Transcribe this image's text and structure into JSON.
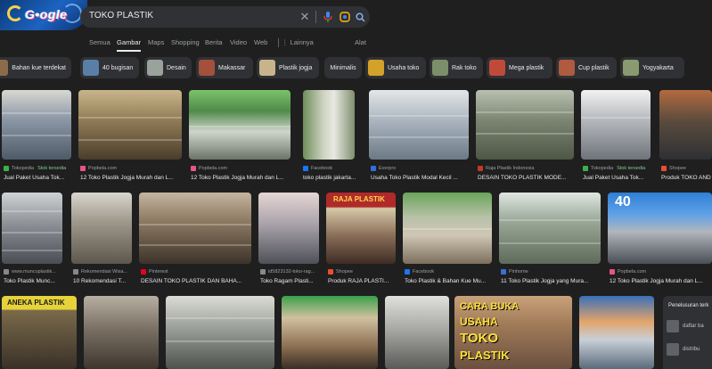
{
  "search": {
    "query": "TOKO PLASTIK",
    "logo_text": "G•ogle"
  },
  "tabs": [
    {
      "label": "Semua"
    },
    {
      "label": "Gambar"
    },
    {
      "label": "Maps"
    },
    {
      "label": "Shopping"
    },
    {
      "label": "Berita"
    },
    {
      "label": "Video"
    },
    {
      "label": "Web"
    },
    {
      "label": "⋮ Lainnya"
    },
    {
      "label": "Alat"
    }
  ],
  "chips": [
    {
      "label": "Bahan kue terdekat",
      "color": "#8c6b4a"
    },
    {
      "label": "40 bugisan",
      "color": "#5a7fa6"
    },
    {
      "label": "Desain",
      "color": "#9aa39b"
    },
    {
      "label": "Makassar",
      "color": "#a3503c"
    },
    {
      "label": "Plastik jogja",
      "color": "#c8b48a"
    },
    {
      "label": "Minimalis",
      "color": "#303134"
    },
    {
      "label": "Usaha toko",
      "color": "#d4a12a"
    },
    {
      "label": "Rak toko",
      "color": "#7b8f6a"
    },
    {
      "label": "Mega plastik",
      "color": "#c04a3a"
    },
    {
      "label": "Cup plastik",
      "color": "#b05a40"
    },
    {
      "label": "Yogyakarta",
      "color": "#8a9a70"
    }
  ],
  "row1": [
    {
      "source": "Tokopedia",
      "badge": "Stok tersedia",
      "caption": "Jual Paket Usaha Tok...",
      "fav": "#3bb14a"
    },
    {
      "source": "Popbela.com",
      "badge": "",
      "caption": "12 Toko Plastik Jogja Murah dan L...",
      "fav": "#e8548a"
    },
    {
      "source": "Popbela.com",
      "badge": "",
      "caption": "12 Toko Plastik Jogja Murah dan L...",
      "fav": "#e8548a"
    },
    {
      "source": "Facebook",
      "badge": "",
      "caption": "toko plastik jakarta...",
      "fav": "#1877f2"
    },
    {
      "source": "Everpro",
      "badge": "",
      "caption": "Usaha Toko Plastik Modal Kecil ...",
      "fav": "#2f6fe0"
    },
    {
      "source": "Raja Plastik Indonesia",
      "badge": "",
      "caption": "DESAIN TOKO PLASTIK MODE...",
      "fav": "#c0392b"
    },
    {
      "source": "Tokopedia",
      "badge": "Stok tersedia",
      "caption": "Jual Paket Usaha Tok...",
      "fav": "#3bb14a"
    },
    {
      "source": "Shopee",
      "badge": "",
      "caption": "Produk TOKO AND",
      "fav": "#ee4d2d"
    }
  ],
  "row2": [
    {
      "source": "www.muncuplastik...",
      "badge": "",
      "caption": "Toko Plastik Munc...",
      "fav": "#888888"
    },
    {
      "source": "Rekomendasi Wisa...",
      "badge": "",
      "caption": "10 Rekomendasi T...",
      "fav": "#888888"
    },
    {
      "source": "Pinterest",
      "badge": "",
      "caption": "DESAIN TOKO PLASTIK DAN BAHA...",
      "fav": "#e60023"
    },
    {
      "source": "id5823132-toko-rag...",
      "badge": "",
      "caption": "Toko Ragam Plasti...",
      "fav": "#888888"
    },
    {
      "source": "Shopee",
      "badge": "",
      "caption": "Produk RAJA PLASTI...",
      "fav": "#ee4d2d"
    },
    {
      "source": "Facebook",
      "badge": "",
      "caption": "Toko Plastik & Bahan Kue Mu...",
      "fav": "#1877f2"
    },
    {
      "source": "Pinhome",
      "badge": "",
      "caption": "11 Toko Plastik Jogja yang Mura...",
      "fav": "#3a6fd8"
    },
    {
      "source": "Popbela.com",
      "badge": "",
      "caption": "12 Toko Plastik Jogja Murah dan L...",
      "fav": "#e8548a"
    }
  ],
  "row2_overlays": {
    "raja": "RAJA PLASTIK",
    "forty": "40"
  },
  "row3_overlays": {
    "aneka": "ANEKA PLASTIK",
    "cara1": "CARA BUKA",
    "cara2": "USAHA",
    "cara3": "TOKO",
    "cara4": "PLASTIK"
  },
  "side_panel": {
    "title": "Penelusuran terk",
    "items": [
      "daftar ba",
      "distribu"
    ]
  },
  "colors": {
    "background": "#1f1f1f",
    "surface": "#303134",
    "text": "#e8eaed",
    "muted": "#9aa0a6"
  }
}
